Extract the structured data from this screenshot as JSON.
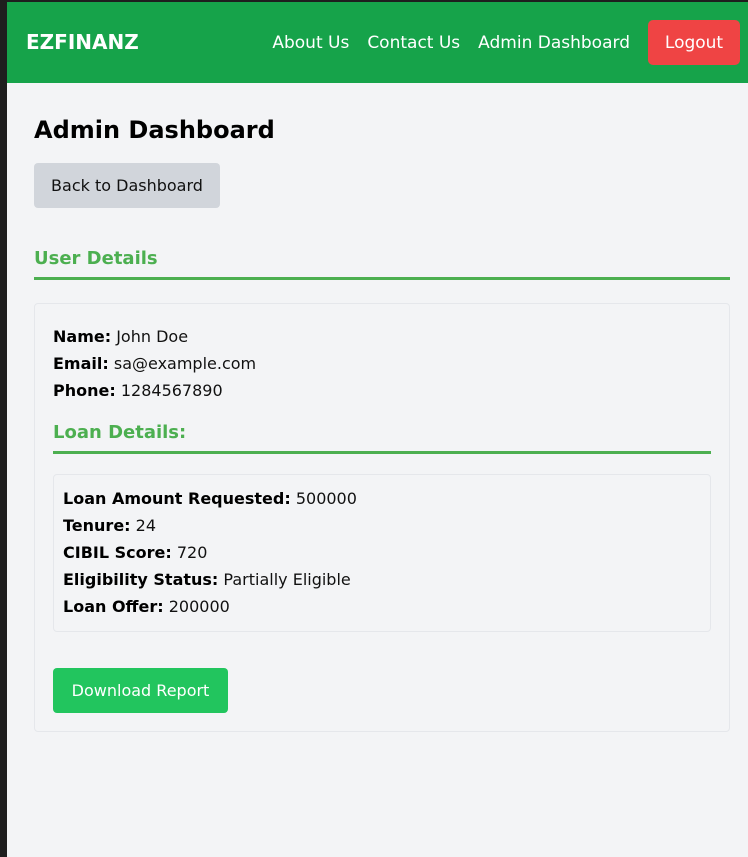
{
  "nav": {
    "brand": "EZFINANZ",
    "links": [
      "About Us",
      "Contact Us",
      "Admin Dashboard"
    ],
    "logout": "Logout"
  },
  "page_title": "Admin Dashboard",
  "back_button": "Back to Dashboard",
  "user_section": {
    "title": "User Details",
    "fields": [
      {
        "label": "Name:",
        "value": "John Doe"
      },
      {
        "label": "Email:",
        "value": "sa@example.com"
      },
      {
        "label": "Phone:",
        "value": "1284567890"
      }
    ]
  },
  "loan_section": {
    "title": "Loan Details:",
    "fields": [
      {
        "label": "Loan Amount Requested:",
        "value": "500000"
      },
      {
        "label": "Tenure:",
        "value": "24"
      },
      {
        "label": "CIBIL Score:",
        "value": "720"
      },
      {
        "label": "Eligibility Status:",
        "value": "Partially Eligible"
      },
      {
        "label": "Loan Offer:",
        "value": "200000"
      }
    ]
  },
  "download_button": "Download Report",
  "colors": {
    "nav": "#16a34a",
    "logout": "#ef4444",
    "accent": "#4caf50",
    "download": "#22c55e"
  }
}
